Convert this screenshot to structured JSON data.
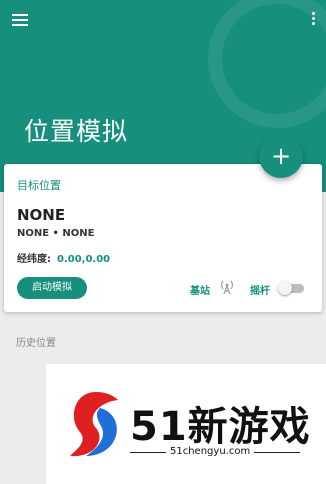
{
  "header": {
    "title": "位置模拟",
    "menu_icon": "hamburger-menu-icon",
    "more_icon": "more-vert-icon",
    "color": "#168f7c"
  },
  "fab": {
    "label": "+",
    "icon": "add-icon"
  },
  "card": {
    "section_label": "目标位置",
    "location_name": "NONE",
    "location_sub": "NONE • NONE",
    "coord_label": "经纬度:",
    "coord_value": "0.00,0.00",
    "start_button": "启动模拟",
    "station_label": "基站",
    "station_icon": "antenna-icon",
    "joystick_label": "摇杆",
    "joystick_on": false
  },
  "history": {
    "label": "历史位置"
  },
  "watermark": {
    "text": "51新游戏",
    "url": "51chengyu.com",
    "logo_colors": [
      "#e02020",
      "#1e6fd8"
    ]
  }
}
